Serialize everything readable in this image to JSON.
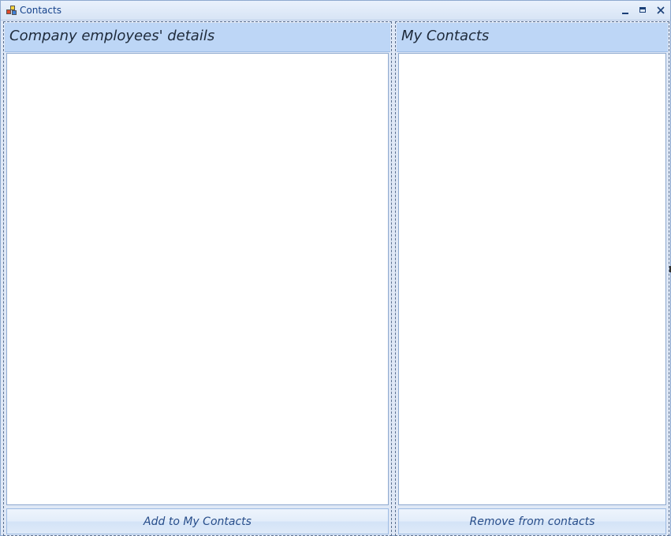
{
  "window": {
    "title": "Contacts"
  },
  "left_panel": {
    "header": "Company employees' details",
    "button_label": "Add to My Contacts"
  },
  "right_panel": {
    "header": "My Contacts",
    "button_label": "Remove from contacts"
  },
  "icons": {
    "app": "app-icon",
    "minimize": "minimize-icon",
    "maximize": "maximize-icon",
    "close": "close-icon"
  },
  "colors": {
    "header_bg": "#bdd6f6",
    "window_bg": "#dfe8f6",
    "title_text": "#15428b",
    "button_text": "#274d8a"
  }
}
